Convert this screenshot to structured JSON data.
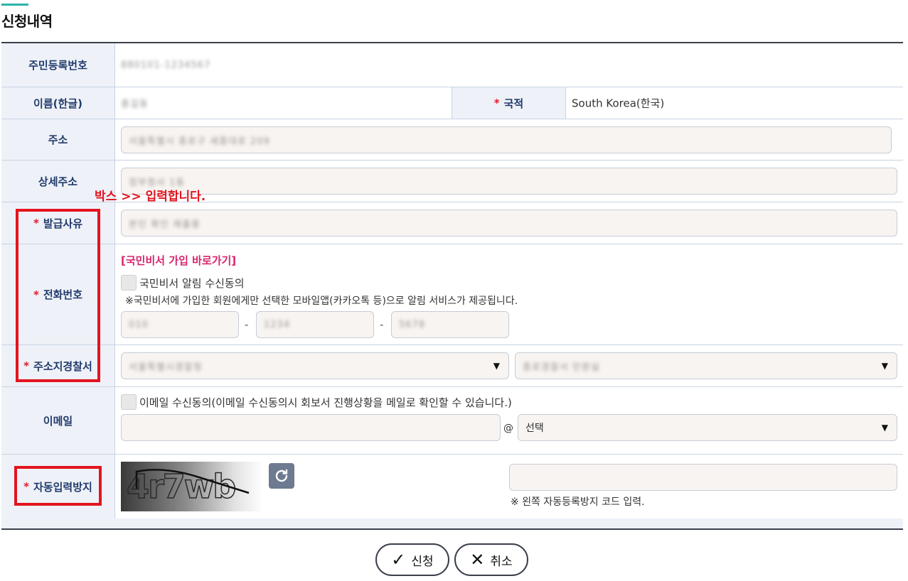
{
  "section": {
    "title": "신청내역"
  },
  "rows": {
    "rrn_label": "주민등록번호",
    "rrn_value": "880101-1234567",
    "name_label": "이름(한글)",
    "name_value": "홍길동",
    "nationality_label": "국적",
    "nationality_value": "South Korea(한국)",
    "address_label": "주소",
    "address_value": "서울특별시 종로구 세종대로 209",
    "detail_address_label": "상세주소",
    "detail_address_value": "정부청사 1동",
    "reason_label": "발급사유",
    "reason_value": "본인 확인 제출용",
    "phone_label": "전화번호",
    "phone_join_link": "[국민비서 가입 바로가기]",
    "phone_consent_label": "국민비서 알림 수신동의",
    "phone_notice": "※국민비서에 가입한 회원에게만 선택한 모바일앱(카카오톡 등)으로 알림 서비스가 제공됩니다.",
    "phone_part1": "010",
    "phone_sep1": "-",
    "phone_part2": "1234",
    "phone_sep2": "-",
    "phone_part3": "5678",
    "police_label": "주소지경찰서",
    "police_select1": "서울특별시경찰청",
    "police_select2": "종로경찰서 민원실",
    "email_label": "이메일",
    "email_consent_label": "이메일 수신동의(이메일 수신동의시 회보서 진행상황을 메일로 확인할 수 있습니다.)",
    "email_at": "@",
    "email_domain_select": "선택",
    "captcha_label": "자동입력방지",
    "captcha_text": "4r7wb",
    "captcha_notice": "※ 왼쪽 자동등록방지 코드 입력.",
    "required_mark": "*"
  },
  "annotation": {
    "text": "박스 >> 입력합니다."
  },
  "buttons": {
    "apply_label": "신청",
    "cancel_label": "취소"
  },
  "icons": {
    "apply": "check-icon",
    "cancel": "x-icon",
    "refresh": "refresh-icon",
    "caret": "caret-down-icon"
  },
  "colors": {
    "accent": "#2bb3a9",
    "required": "#e3182d",
    "label_text": "#223a6b",
    "label_bg": "#eef2f8",
    "annotation": "#e3141f",
    "link": "#d6246e"
  }
}
